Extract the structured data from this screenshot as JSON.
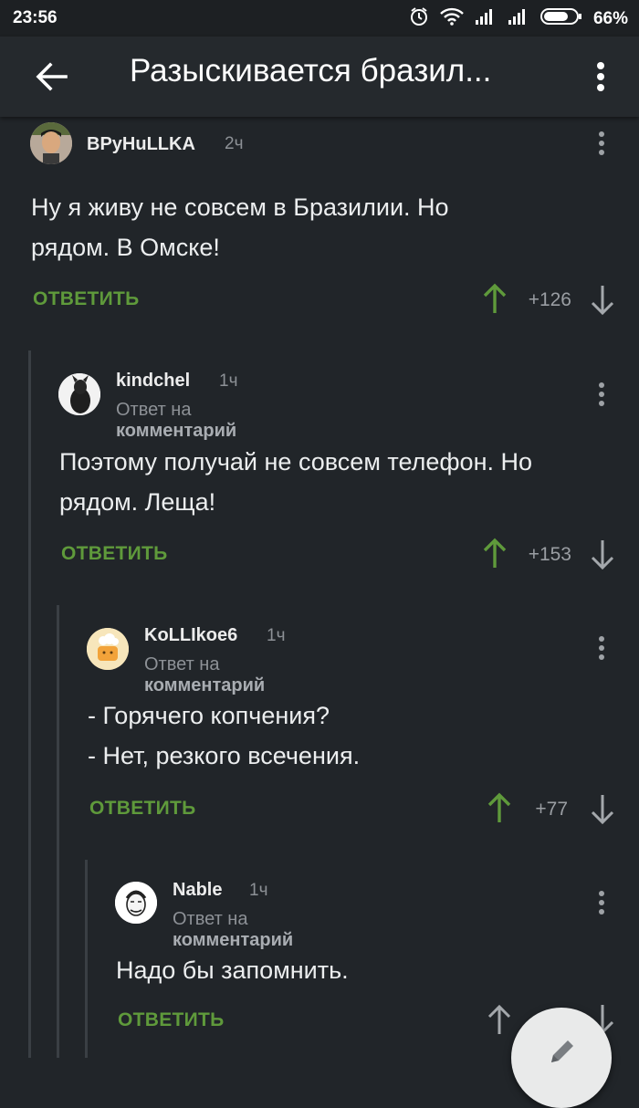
{
  "status_bar": {
    "time": "23:56",
    "battery_percent": "66%"
  },
  "app_bar": {
    "title": "Разыскивается бразил..."
  },
  "colors": {
    "background": "#212529",
    "accent_green": "#5f9a3b",
    "muted": "#8d9196"
  },
  "comments": [
    {
      "author": "BPyHuLLKA",
      "ago": "2ч",
      "reply_prefix": "",
      "reply_target": "",
      "body": [
        "Ну я живу не совсем в Бразилии. Но",
        "рядом. В Омске!"
      ],
      "reply_label": "ОТВЕТИТЬ",
      "score": "+126"
    },
    {
      "author": "kindchel",
      "ago": "1ч",
      "reply_prefix": "Ответ на",
      "reply_target": "комментарий",
      "body": [
        "Поэтому получай не совсем телефон. Но",
        "рядом. Леща!"
      ],
      "reply_label": "ОТВЕТИТЬ",
      "score": "+153"
    },
    {
      "author": "KoLLIkoe6",
      "ago": "1ч",
      "reply_prefix": "Ответ на",
      "reply_target": "комментарий",
      "body": [
        "- Горячего копчения?",
        "- Нет, резкого всечения."
      ],
      "reply_label": "ОТВЕТИТЬ",
      "score": "+77"
    },
    {
      "author": "Nable",
      "ago": "1ч",
      "reply_prefix": "Ответ на",
      "reply_target": "комментарий",
      "body": [
        "Надо бы запомнить."
      ],
      "reply_label": "ОТВЕТИТЬ",
      "score": ""
    }
  ],
  "icons": {
    "back": "arrow-left-icon",
    "menu": "more-vert-icon",
    "upvote": "arrow-up-icon",
    "downvote": "arrow-down-icon",
    "fab": "pencil-icon"
  }
}
